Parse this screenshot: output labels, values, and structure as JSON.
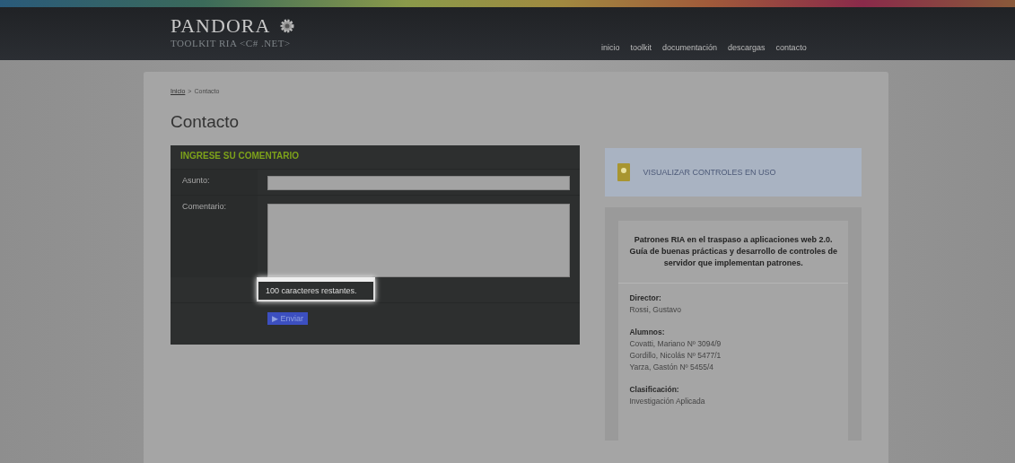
{
  "header": {
    "logo_title": "PANDORA",
    "logo_subtitle": "TOOLKIT RIA <C# .NET>",
    "nav": [
      {
        "label": "inicio"
      },
      {
        "label": "toolkit"
      },
      {
        "label": "documentación"
      },
      {
        "label": "descargas"
      },
      {
        "label": "contacto"
      }
    ]
  },
  "breadcrumb": {
    "link": "Inicio",
    "separator": ">",
    "current": "Contacto"
  },
  "page_title": "Contacto",
  "form": {
    "title": "INGRESE SU COMENTARIO",
    "subject_label": "Asunto:",
    "comment_label": "Comentario:",
    "counter": "100 caracteres restantes.",
    "submit": "▶ Enviar"
  },
  "controls_button": "VISUALIZAR CONTROLES EN USO",
  "info": {
    "title": "Patrones RIA en el traspaso a aplicaciones web 2.0. Guía de buenas prácticas y desarrollo de controles de servidor que implementan patrones.",
    "sections": [
      {
        "heading": "Director:",
        "lines": [
          "Rossi, Gustavo"
        ]
      },
      {
        "heading": "Alumnos:",
        "lines": [
          "Covatti, Mariano Nº 3094/9",
          "Gordillo, Nicolás Nº 5477/1",
          "Yarza, Gastón Nº 5455/4"
        ]
      },
      {
        "heading": "Clasificación:",
        "lines": [
          "Investigación Aplicada"
        ]
      }
    ]
  }
}
